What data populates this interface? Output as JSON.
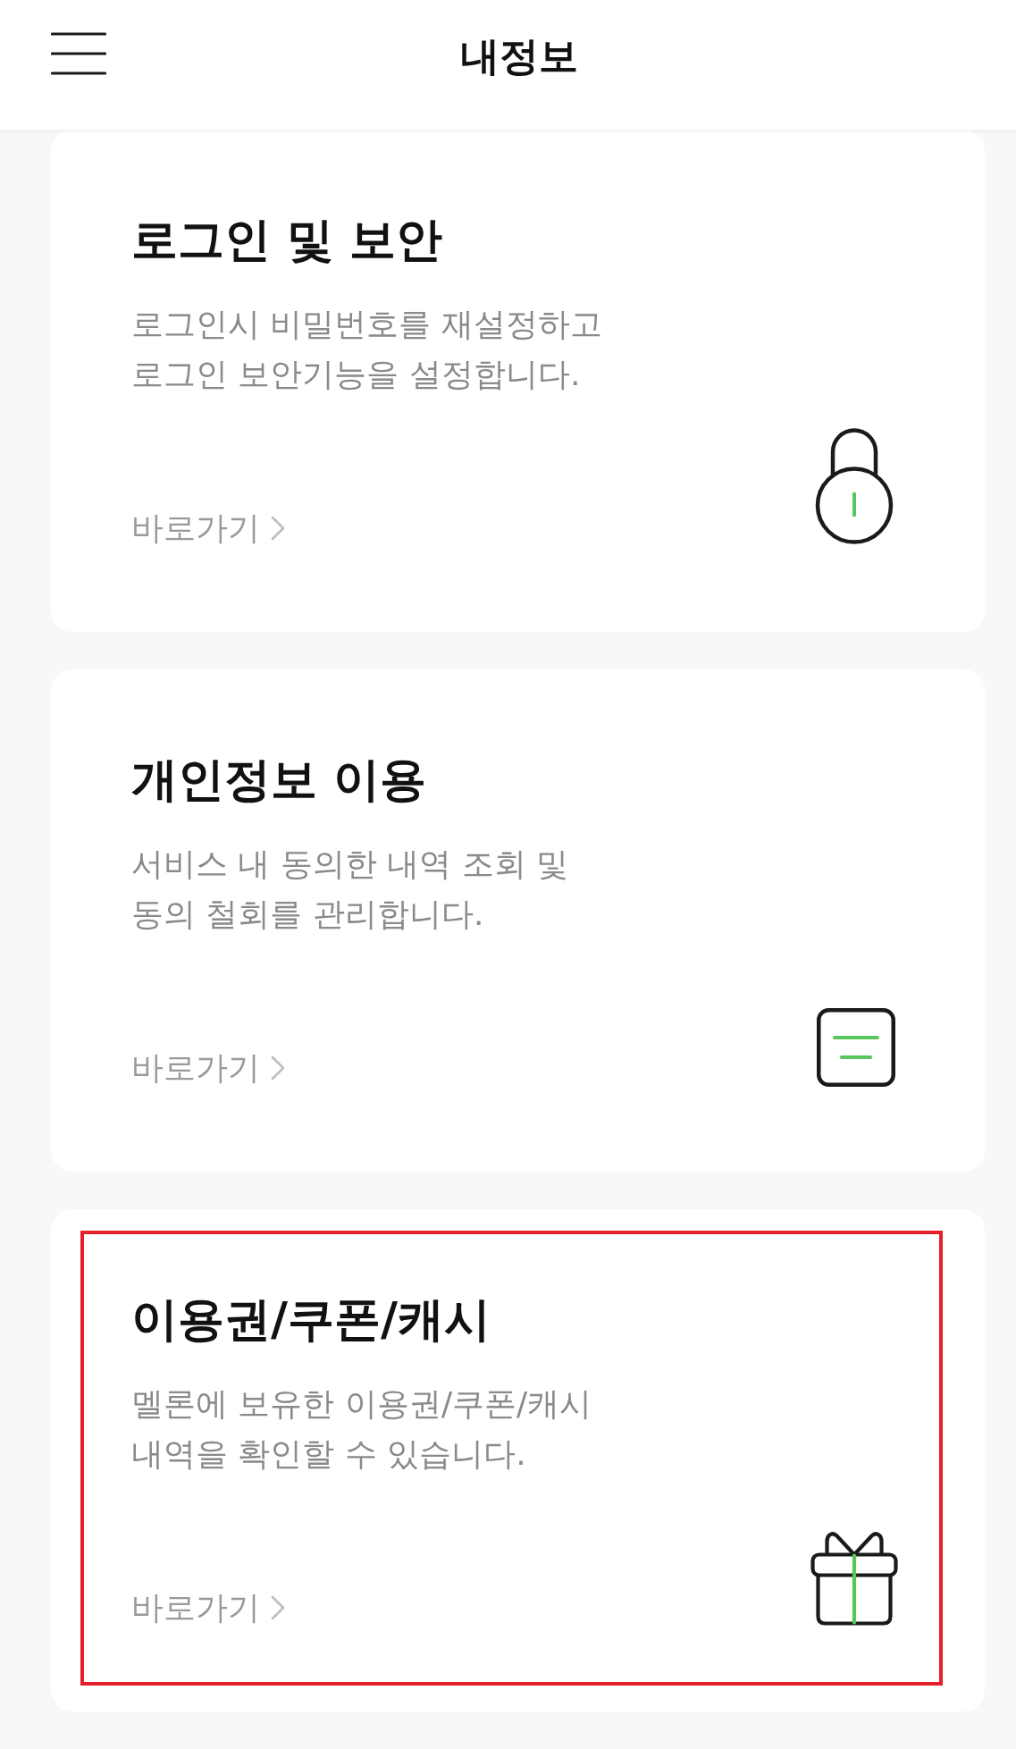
{
  "header": {
    "title": "내정보"
  },
  "cards": [
    {
      "title": "로그인 및 보안",
      "description": "로그인시 비밀번호를 재설정하고\n로그인 보안기능을 설정합니다.",
      "link": "바로가기",
      "highlighted": false
    },
    {
      "title": "개인정보 이용",
      "description": "서비스 내 동의한 내역 조회 및\n동의 철회를 관리합니다.",
      "link": "바로가기",
      "highlighted": false
    },
    {
      "title": "이용권/쿠폰/캐시",
      "description": "멜론에 보유한 이용권/쿠폰/캐시\n내역을 확인할 수 있습니다.",
      "link": "바로가기",
      "highlighted": true
    }
  ]
}
